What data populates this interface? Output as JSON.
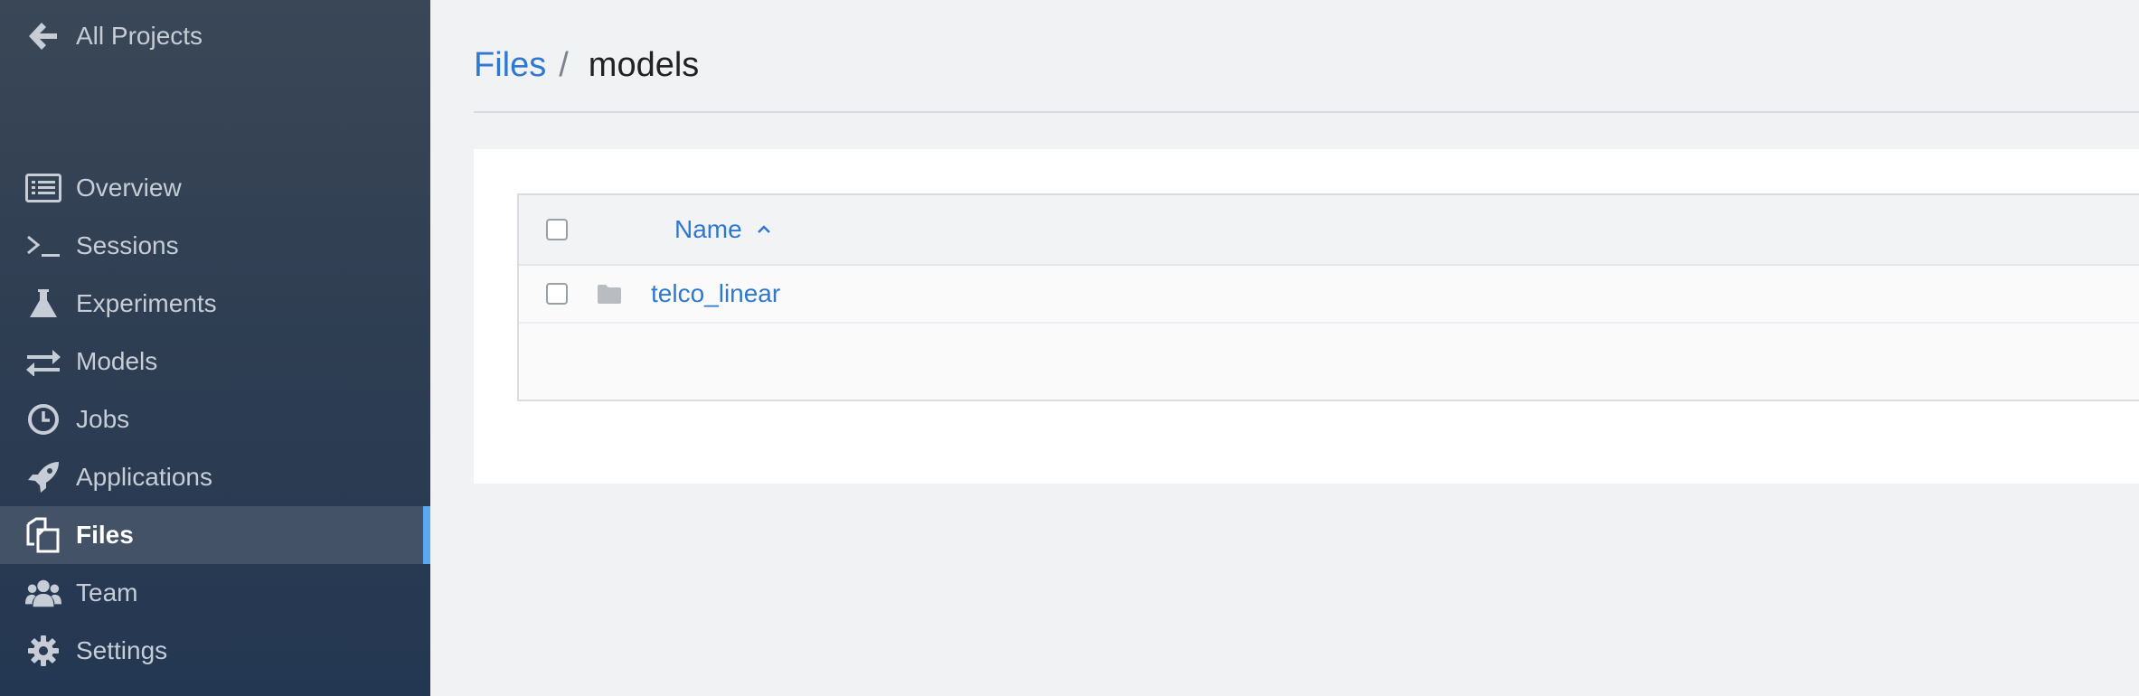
{
  "sidebar": {
    "back": {
      "label": "All Projects",
      "icon": "arrow-left-icon"
    },
    "items": [
      {
        "label": "Overview",
        "icon": "list-icon",
        "active": false
      },
      {
        "label": "Sessions",
        "icon": "terminal-icon",
        "active": false
      },
      {
        "label": "Experiments",
        "icon": "flask-icon",
        "active": false
      },
      {
        "label": "Models",
        "icon": "exchange-icon",
        "active": false
      },
      {
        "label": "Jobs",
        "icon": "clock-icon",
        "active": false
      },
      {
        "label": "Applications",
        "icon": "rocket-icon",
        "active": false
      },
      {
        "label": "Files",
        "icon": "files-icon",
        "active": true
      },
      {
        "label": "Team",
        "icon": "users-icon",
        "active": false
      },
      {
        "label": "Settings",
        "icon": "gear-icon",
        "active": false
      }
    ],
    "accent_color": "#5aa8f0"
  },
  "breadcrumb": {
    "root": "Files",
    "separator": "/",
    "current": "models"
  },
  "table": {
    "header": {
      "name": "Name",
      "sort": "ascending"
    },
    "rows": [
      {
        "name": "telco_linear",
        "type": "folder",
        "icon": "folder-icon"
      }
    ]
  },
  "colors": {
    "link": "#2f78d0",
    "sidebar_bg": "#2f3e52",
    "page_bg": "#f1f2f4"
  }
}
